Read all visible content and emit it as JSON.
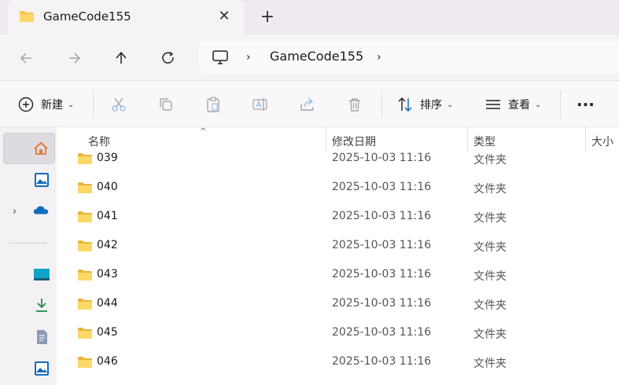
{
  "tab": {
    "title": "GameCode155",
    "close_glyph": "✕",
    "new_tab_glyph": "+"
  },
  "address": {
    "crumb": "GameCode155",
    "chevron": "›"
  },
  "toolbar": {
    "new_label": "新建",
    "sort_label": "排序",
    "view_label": "查看",
    "more_glyph": "···",
    "caret": "⌄"
  },
  "columns": {
    "name": "名称",
    "modified": "修改日期",
    "type": "类型",
    "size": "大小",
    "sort_indicator": "^"
  },
  "files": [
    {
      "name": "039",
      "modified": "2025-10-03 11:16",
      "type": "文件夹"
    },
    {
      "name": "040",
      "modified": "2025-10-03 11:16",
      "type": "文件夹"
    },
    {
      "name": "041",
      "modified": "2025-10-03 11:16",
      "type": "文件夹"
    },
    {
      "name": "042",
      "modified": "2025-10-03 11:16",
      "type": "文件夹"
    },
    {
      "name": "043",
      "modified": "2025-10-03 11:16",
      "type": "文件夹"
    },
    {
      "name": "044",
      "modified": "2025-10-03 11:16",
      "type": "文件夹"
    },
    {
      "name": "045",
      "modified": "2025-10-03 11:16",
      "type": "文件夹"
    },
    {
      "name": "046",
      "modified": "2025-10-03 11:16",
      "type": "文件夹"
    }
  ],
  "icons": {
    "folder": "folder-icon",
    "back": "arrow-left-icon",
    "forward": "arrow-right-icon",
    "up": "arrow-up-icon",
    "refresh": "refresh-icon",
    "pc": "monitor-icon",
    "new": "plus-circle-icon",
    "cut": "scissors-icon",
    "copy": "copy-icon",
    "paste": "clipboard-icon",
    "rename": "rename-icon",
    "share": "share-icon",
    "delete": "trash-icon",
    "sort": "sort-arrows-icon",
    "view": "view-lines-icon",
    "home": "home-icon",
    "gallery": "gallery-icon",
    "onedrive": "cloud-icon",
    "desktop": "desktop-icon",
    "downloads": "download-icon",
    "documents": "document-icon",
    "pictures": "pictures-icon"
  },
  "colors": {
    "folder": "#f7c948",
    "accent": "#0067c0",
    "home": "#e07b39",
    "cloud": "#0f6cbd"
  }
}
